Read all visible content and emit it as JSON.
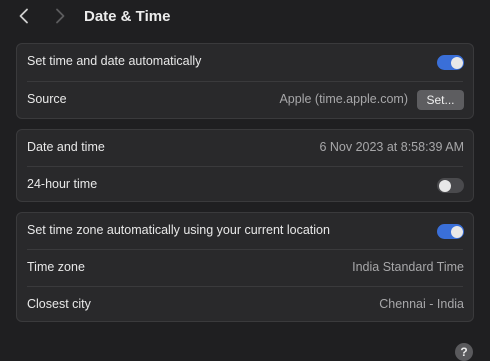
{
  "header": {
    "title": "Date & Time",
    "back_icon": "chevron-left-icon",
    "forward_icon": "chevron-right-icon"
  },
  "auto_group": {
    "set_automatically_label": "Set time and date automatically",
    "set_automatically_on": true,
    "source_label": "Source",
    "source_value": "Apple (time.apple.com)",
    "set_button_label": "Set..."
  },
  "datetime_group": {
    "date_time_label": "Date and time",
    "date_time_value": "6 Nov 2023 at 8:58:39 AM",
    "hour24_label": "24-hour time",
    "hour24_on": false
  },
  "timezone_group": {
    "auto_tz_label": "Set time zone automatically using your current location",
    "auto_tz_on": true,
    "timezone_label": "Time zone",
    "timezone_value": "India Standard Time",
    "closest_city_label": "Closest city",
    "closest_city_value": "Chennai - India"
  },
  "help": {
    "label": "?"
  },
  "colors": {
    "accent": "#3a6fd8",
    "background": "#1f1f21",
    "panel": "#29292b"
  }
}
